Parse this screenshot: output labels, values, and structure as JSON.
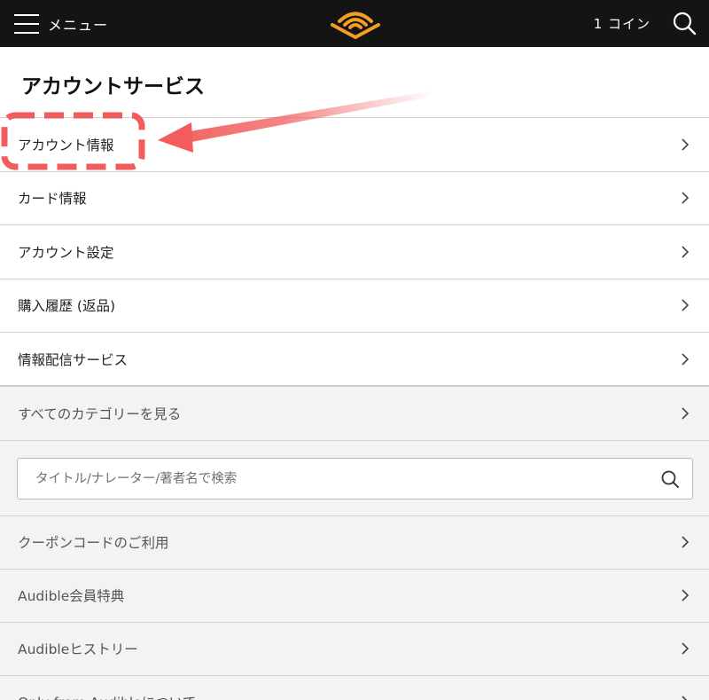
{
  "header": {
    "menu_label": "メニュー",
    "coins": "1 コイン",
    "icons": {
      "menu": "hamburger-icon",
      "logo": "audible-logo",
      "search": "search-icon"
    },
    "colors": {
      "bar": "#141414",
      "logo": "#f39c26"
    }
  },
  "section": {
    "title": "アカウントサービス"
  },
  "account_items": [
    {
      "label": "アカウント情報"
    },
    {
      "label": "カード情報"
    },
    {
      "label": "アカウント設定"
    },
    {
      "label": "購入履歴 (返品)"
    },
    {
      "label": "情報配信サービス"
    }
  ],
  "browse": {
    "all_categories": "すべてのカテゴリーを見る",
    "search_placeholder": "タイトル/ナレーター/著者名で検索",
    "items": [
      {
        "label": "クーポンコードのご利用"
      },
      {
        "label": "Audible会員特典"
      },
      {
        "label": "Audibleヒストリー"
      },
      {
        "label": "Only from Audibleについて"
      }
    ]
  },
  "annotation": {
    "highlight_color": "#f25c5c",
    "target": "アカウント情報"
  }
}
